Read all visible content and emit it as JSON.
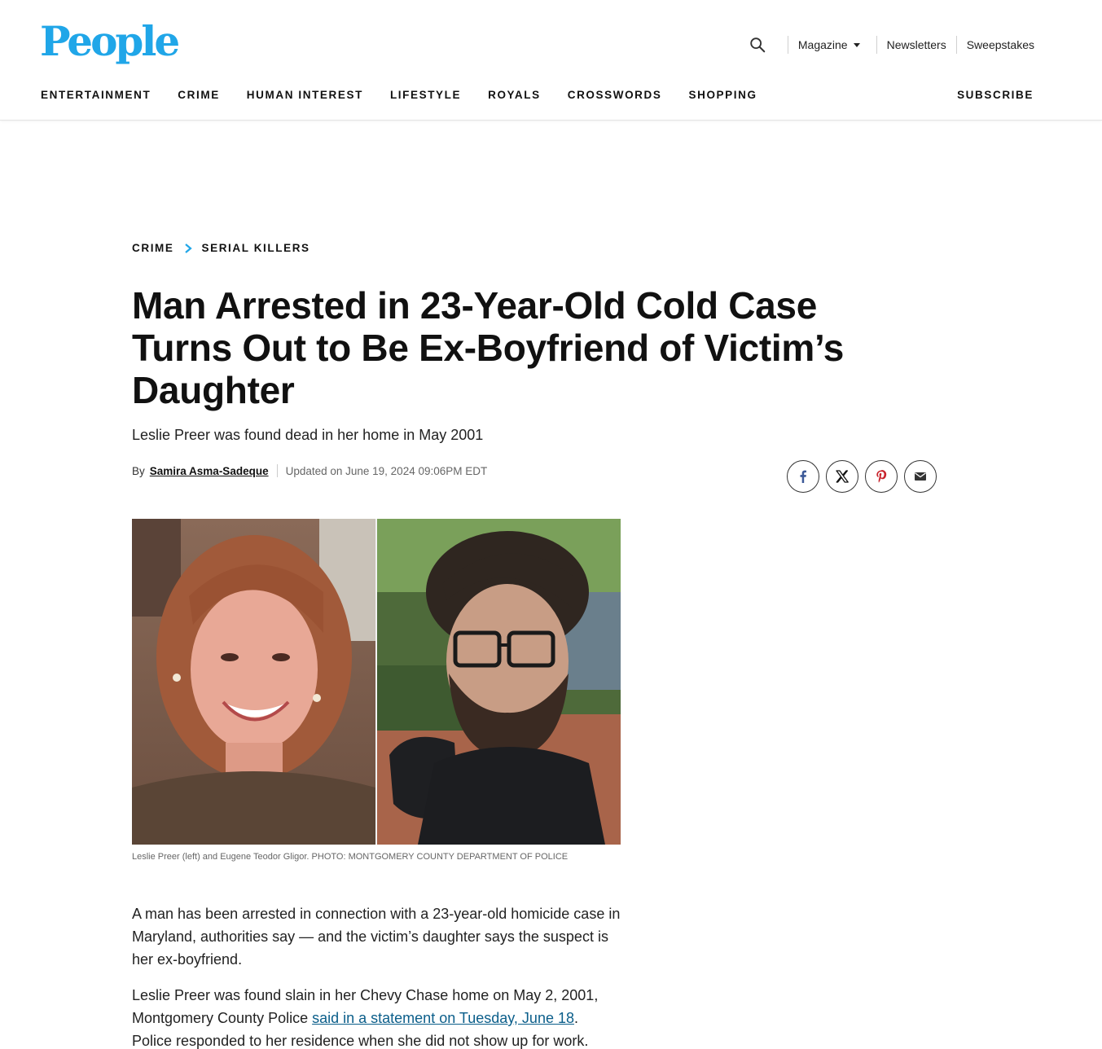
{
  "header": {
    "logo": "People",
    "utility": {
      "magazine": "Magazine",
      "newsletters": "Newsletters",
      "sweepstakes": "Sweepstakes"
    },
    "nav": [
      "ENTERTAINMENT",
      "CRIME",
      "HUMAN INTEREST",
      "LIFESTYLE",
      "ROYALS",
      "CROSSWORDS",
      "SHOPPING"
    ],
    "subscribe": "SUBSCRIBE"
  },
  "breadcrumb": [
    "CRIME",
    "SERIAL KILLERS"
  ],
  "article": {
    "title": "Man Arrested in 23-Year-Old Cold Case Turns Out to Be Ex-Boyfriend of Victim’s Daughter",
    "dek": "Leslie Preer was found dead in her home in May 2001",
    "by_label": "By",
    "author": "Samira Asma-Sadeque",
    "updated": "Updated on June 19, 2024 09:06PM EDT",
    "caption": "Leslie Preer (left) and Eugene Teodor Gligor. PHOTO: MONTGOMERY COUNTY DEPARTMENT OF POLICE",
    "p1": "A man has been arrested in connection with a 23-year-old homicide case in Maryland, authorities say — and the victim’s daughter says the suspect is her ex-boyfriend.",
    "p2_before": "Leslie Preer was found slain in her Chevy Chase home on May 2, 2001, Montgomery County Police ",
    "p2_link": "said in a statement on Tuesday, June 18",
    "p2_after": ". Police responded to her residence when she did not show up for work."
  },
  "share": [
    "facebook-icon",
    "x-icon",
    "pinterest-icon",
    "email-icon"
  ],
  "colors": {
    "brand": "#20a6e8",
    "link": "#0b5e8a",
    "chevron": "#20a6e8"
  }
}
